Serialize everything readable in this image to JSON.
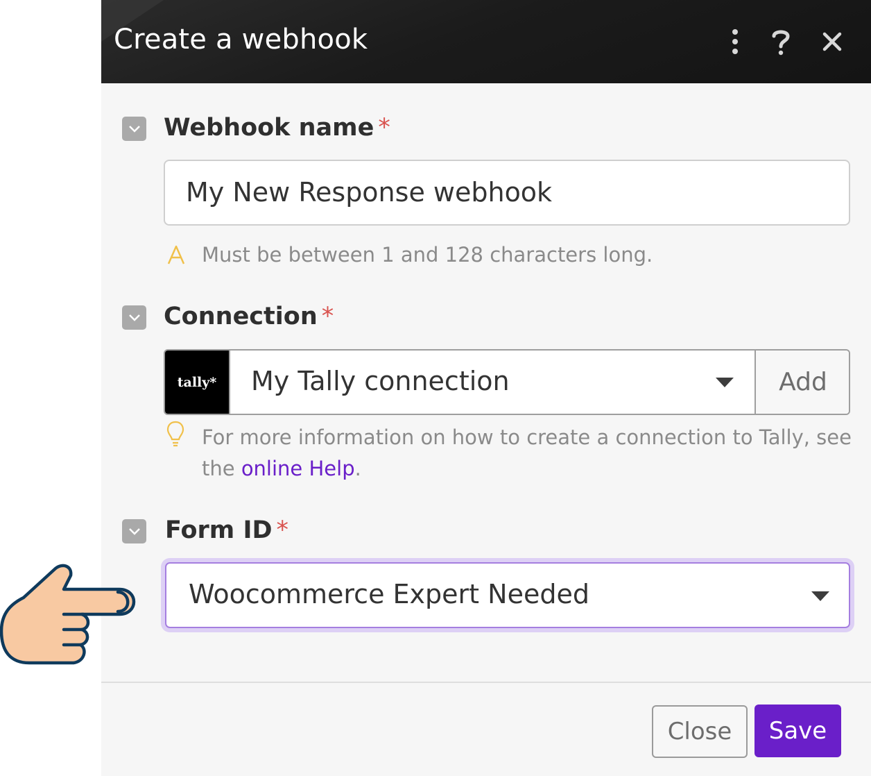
{
  "dialog": {
    "title": "Create a webhook",
    "icons": [
      "more-vertical-icon",
      "help-icon",
      "close-icon"
    ]
  },
  "fields": {
    "webhook_name": {
      "label": "Webhook name",
      "required_mark": "*",
      "value": "My New Response webhook",
      "hint": "Must be between 1 and 128 characters long."
    },
    "connection": {
      "label": "Connection",
      "required_mark": "*",
      "logo_text": "tally*",
      "value": "My Tally connection",
      "add_label": "Add",
      "hint_prefix": "For more information on how to create a connection to Tally, see the",
      "hint_link": "online Help",
      "hint_suffix": "."
    },
    "form_id": {
      "label": "Form ID",
      "required_mark": "*",
      "value": "Woocommerce Expert Needed"
    }
  },
  "footer": {
    "close_label": "Close",
    "save_label": "Save"
  },
  "colors": {
    "accent": "#6a1fc9",
    "required": "#d9534f",
    "focus_ring": "#c9b6ee",
    "header_bg": "#1b1b1b",
    "pointer_fill": "#f8c9a2",
    "pointer_stroke": "#0f3a5c"
  }
}
